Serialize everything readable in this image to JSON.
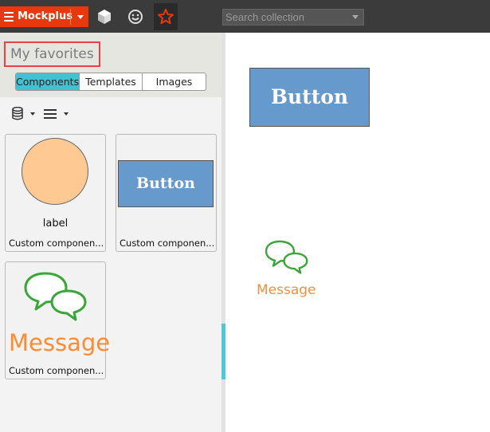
{
  "app": {
    "brand": "Mockplus"
  },
  "search": {
    "placeholder": "Search collection"
  },
  "panel": {
    "title": "My favorites",
    "tabs": [
      {
        "label": "Components",
        "active": true
      },
      {
        "label": "Templates",
        "active": false
      },
      {
        "label": "Images",
        "active": false
      }
    ],
    "cards": [
      {
        "label": "label",
        "caption": "Custom componen..."
      },
      {
        "preview_text": "Button",
        "caption": "Custom componen..."
      },
      {
        "preview_text": "Message",
        "caption": "Custom componen..."
      }
    ]
  },
  "canvas": {
    "button_text": "Button",
    "message_text": "Message"
  },
  "colors": {
    "brand": "#e8380d",
    "topbar": "#3b3b3b",
    "accent_tab": "#41c1d1",
    "button_fill": "#6699cc",
    "circle_fill": "#fec993",
    "message_orange": "#fc8c33",
    "bubble_green": "#3aa63a",
    "highlight_red": "#e7414a"
  },
  "icons": [
    "menu-icon",
    "chevron-down-icon",
    "cube-icon",
    "smiley-icon",
    "star-icon",
    "database-icon",
    "list-icon",
    "chat-bubbles-icon"
  ]
}
